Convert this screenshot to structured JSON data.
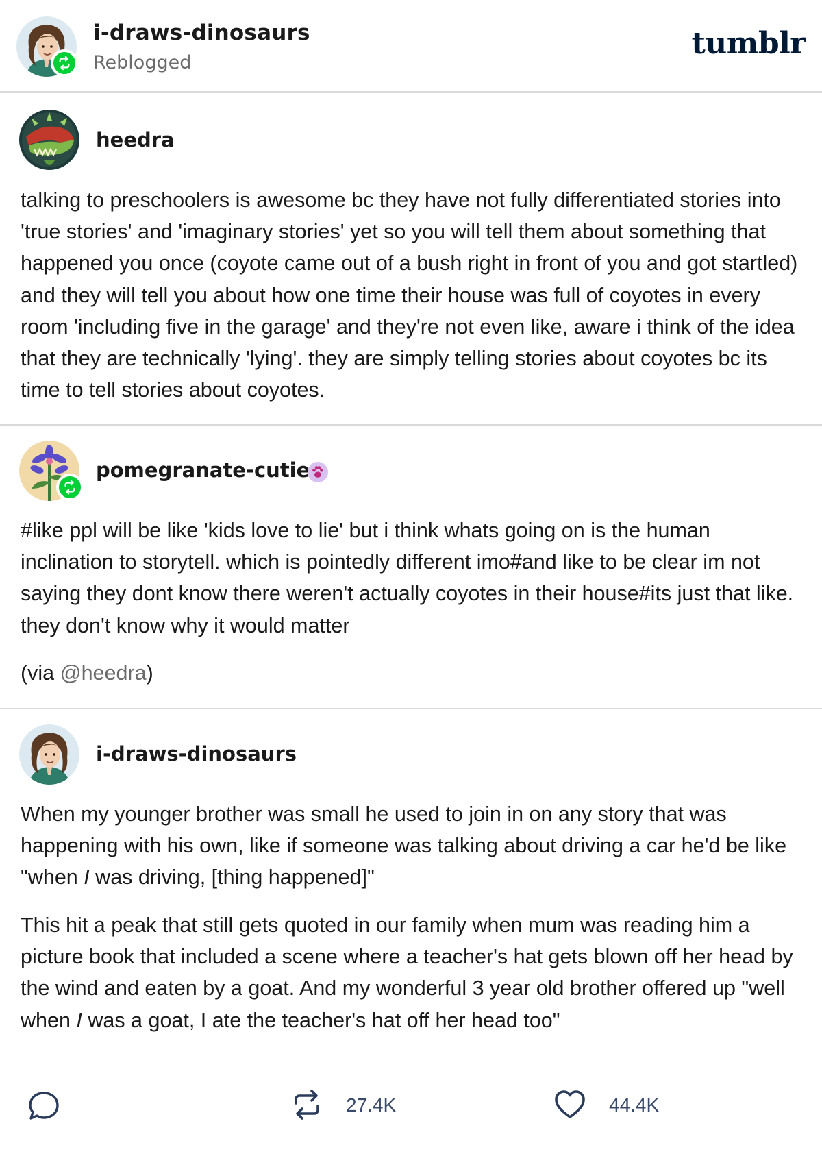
{
  "header": {
    "blog_name": "i-draws-dinosaurs",
    "subtitle": "Reblogged",
    "logo": "tumblr"
  },
  "posts": [
    {
      "author": "heedra",
      "paragraphs": [
        "talking to preschoolers is awesome bc they have not fully differentiated stories into 'true stories' and 'imaginary stories' yet so you will tell them about something that happened you once (coyote came out of a bush right in front of you and got startled) and they will tell you about how one time their house was full of coyotes in every room 'including five in the garage' and they're not even like, aware i think of the idea that they are technically 'lying'. they are simply telling stories about coyotes bc its time to tell stories about coyotes."
      ]
    },
    {
      "author": "pomegranate-cuties",
      "badge_icon": "paw-icon",
      "paragraphs": [
        "#like ppl will be like 'kids love to lie' but i think whats going on is the human inclination to storytell. which is pointedly different imo#and like to be clear im not saying they dont know there weren't actually coyotes in their house#its just that like. they don't know why it would matter"
      ],
      "via_prefix": "(via ",
      "via_mention": "@heedra",
      "via_suffix": ")"
    },
    {
      "author": "i-draws-dinosaurs",
      "p1_before": "When my younger brother was small he used to join in on any story that was happening with his own, like if someone was talking about driving a car he'd be like \"when ",
      "p1_italic": "I",
      "p1_after": " was driving, [thing happened]\"",
      "p2_before": "This hit a peak that still gets quoted in our family when mum was reading him a picture book that included a scene where a teacher's hat gets blown off her head by the wind and eaten by a goat. And my wonderful 3 year old brother offered up \"well when ",
      "p2_italic": "I",
      "p2_after": " was a goat, I ate the teacher's hat off her head too\""
    }
  ],
  "footer": {
    "reblog_count": "27.4K",
    "like_count": "44.4K"
  },
  "colors": {
    "reblog_green": "#00cf35",
    "logo_navy": "#001935",
    "muted_text": "#6b6b6b",
    "divider": "#d9d9d9"
  }
}
